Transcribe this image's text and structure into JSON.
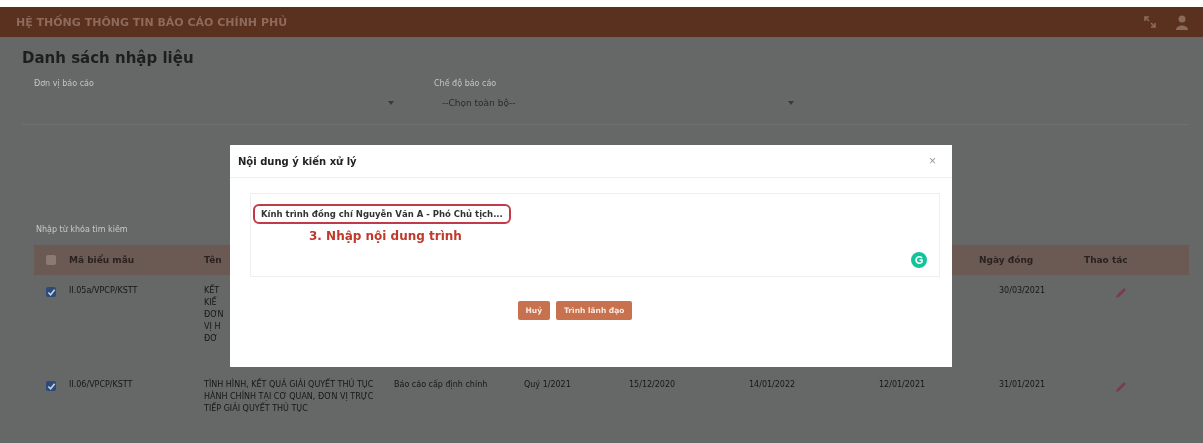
{
  "header": {
    "title": "HỆ THỐNG THÔNG TIN BÁO CÁO CHÍNH PHỦ"
  },
  "page_title": "Danh sách nhập liệu",
  "filters": [
    {
      "label": "Đơn vị báo cáo"
    },
    {
      "label": "Chế độ báo cáo",
      "value": "--Chọn toàn bộ--"
    }
  ],
  "search": {
    "placeholder": "Nhập từ khóa tìm kiếm"
  },
  "table": {
    "all_checked": false,
    "columns": [
      "",
      "Mã biểu mẫu",
      "Tên",
      "",
      "",
      "",
      "",
      "",
      "Ngày đóng",
      "Thao tác"
    ],
    "rows": [
      {
        "checked": true,
        "code": "II.05a/VPCP/KSTT",
        "name": "KẾT\nKIẾ\nĐƠN\nVỊ H\nĐƠ",
        "type": "",
        "period": "",
        "date_1": "",
        "date_2": "",
        "date_3": "",
        "close_date": "30/03/2021"
      },
      {
        "checked": true,
        "code": "II.06/VPCP/KSTT",
        "name": "TÌNH HÌNH, KẾT QUẢ GIẢI QUYẾT THỦ TỤC HÀNH CHÍNH TẠI CƠ QUAN, ĐƠN VỊ TRỰC TIẾP GIẢI QUYẾT THỦ TỤC",
        "type": "Báo cáo cấp định chính",
        "period": "Quý 1/2021",
        "date_1": "15/12/2020",
        "date_2": "14/01/2022",
        "date_3": "12/01/2021",
        "close_date": "31/01/2021"
      }
    ]
  },
  "dialog": {
    "title": "Nội dung ý kiến xử lý",
    "close": "×",
    "value": "Kính trình đồng chí Nguyễn Văn A - Phó Chủ tịch...",
    "annotation": "3. Nhập nội dung trình",
    "buttons": [
      "Huỷ",
      "Trình lãnh đạo"
    ]
  }
}
